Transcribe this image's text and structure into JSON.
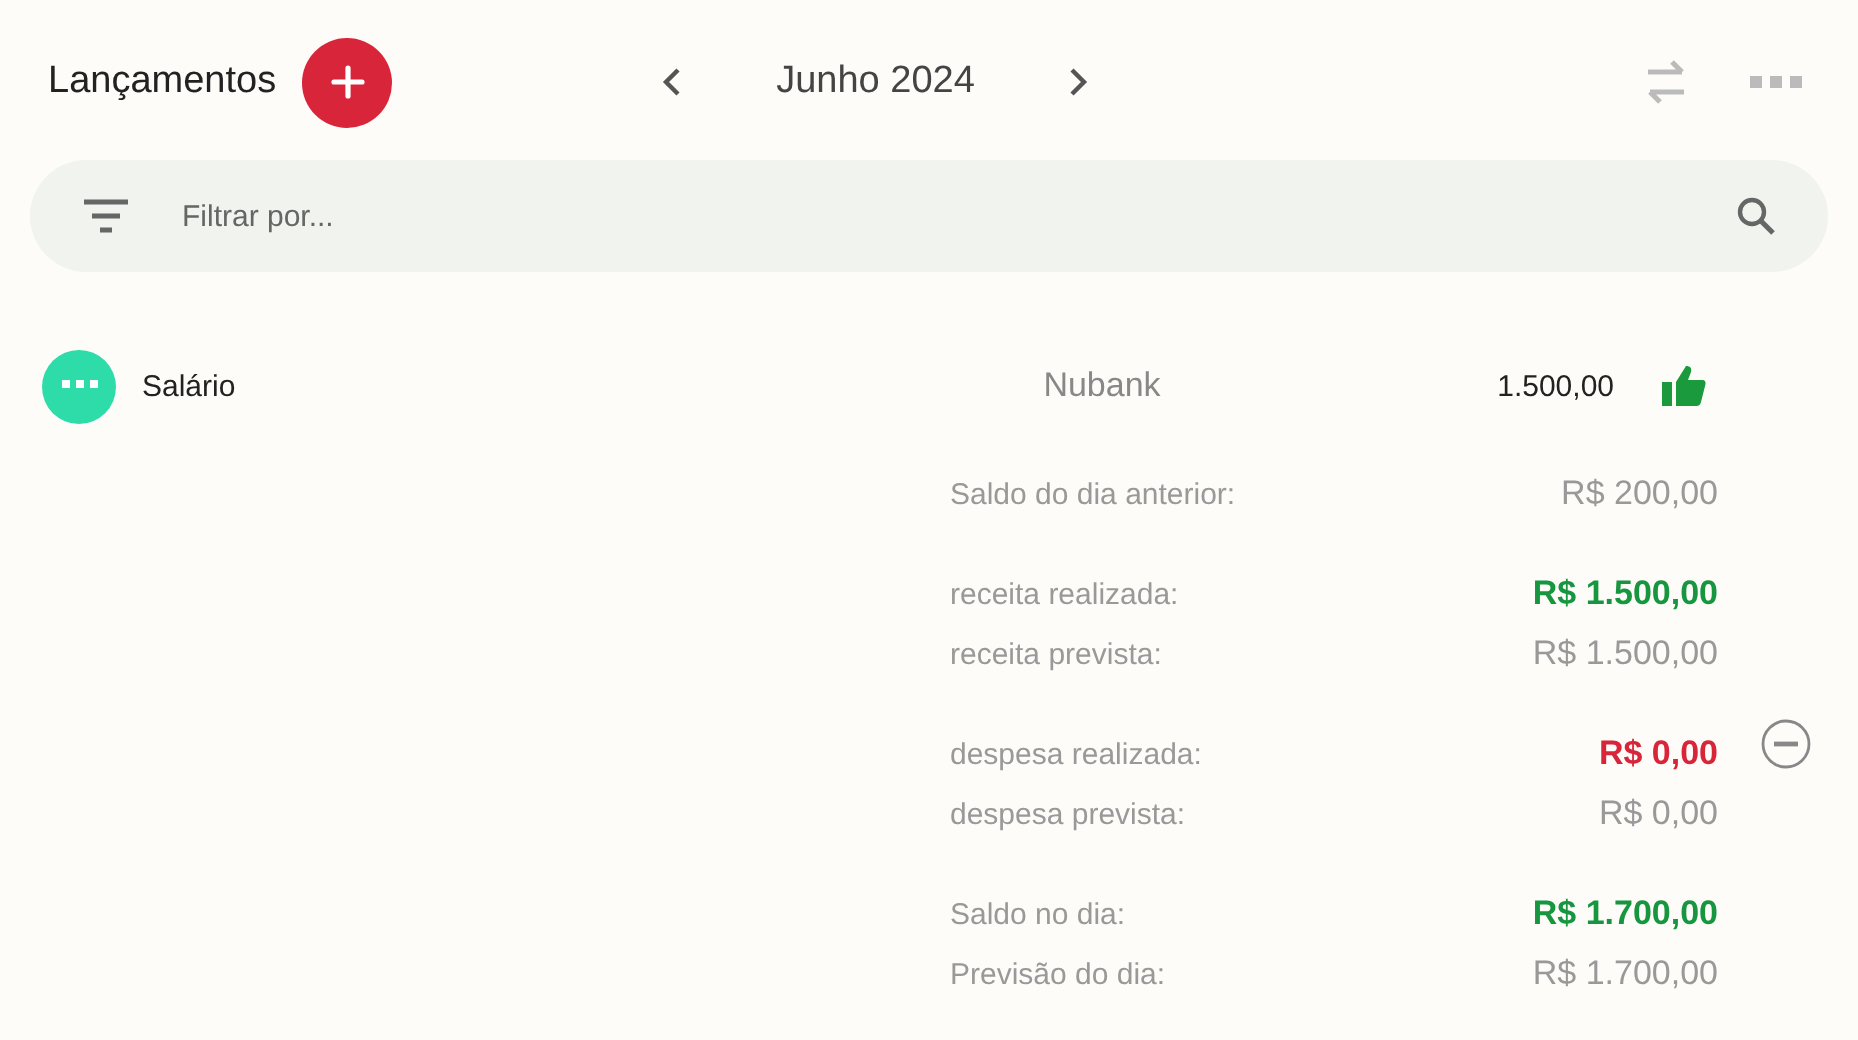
{
  "header": {
    "title": "Lançamentos",
    "month": "Junho 2024"
  },
  "search": {
    "placeholder": "Filtrar por..."
  },
  "entries": [
    {
      "description": "Salário",
      "color": "#2edcaa",
      "account": "Nubank",
      "amount": "1.500,00",
      "confirmed": true
    }
  ],
  "summary": [
    {
      "lines": [
        {
          "label": "Saldo do dia anterior:",
          "value": "R$ 200,00",
          "kind": "neutral"
        }
      ]
    },
    {
      "lines": [
        {
          "label": "receita realizada:",
          "value": "R$ 1.500,00",
          "kind": "positive"
        },
        {
          "label": "receita prevista:",
          "value": "R$ 1.500,00",
          "kind": "neutral"
        }
      ]
    },
    {
      "lines": [
        {
          "label": "despesa realizada:",
          "value": "R$ 0,00",
          "kind": "negative"
        },
        {
          "label": "despesa prevista:",
          "value": "R$ 0,00",
          "kind": "neutral"
        }
      ]
    },
    {
      "lines": [
        {
          "label": "Saldo no dia:",
          "value": "R$ 1.700,00",
          "kind": "positive"
        },
        {
          "label": "Previsão do dia:",
          "value": "R$ 1.700,00",
          "kind": "neutral"
        }
      ]
    }
  ]
}
